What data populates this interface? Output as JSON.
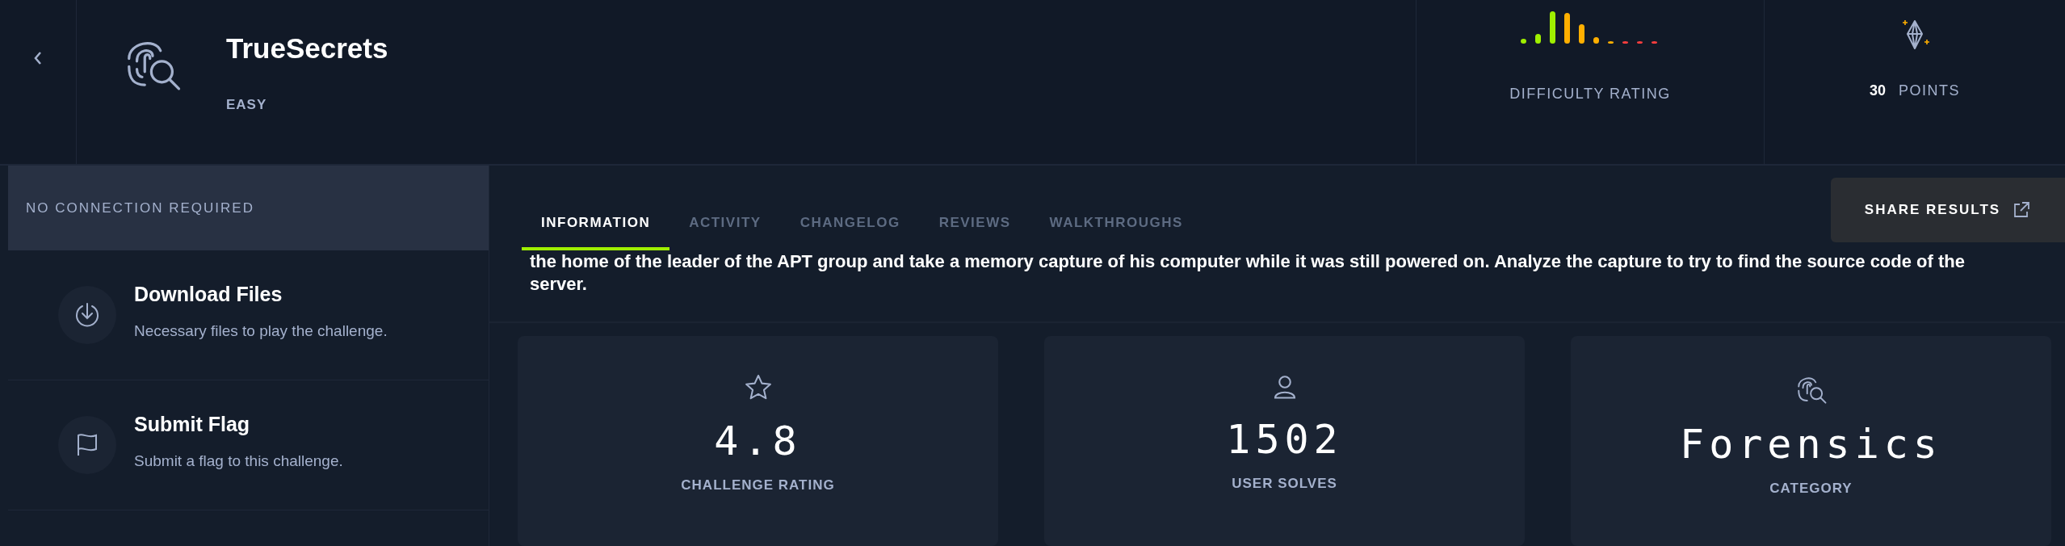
{
  "header": {
    "title": "TrueSecrets",
    "difficulty": "EASY",
    "difficulty_rating_label": "DIFFICULTY RATING",
    "points_value": "30",
    "points_label": "POINTS"
  },
  "sidebar": {
    "banner": "NO CONNECTION REQUIRED",
    "items": [
      {
        "kind": "download",
        "title": "Download Files",
        "subtitle": "Necessary files to play the challenge."
      },
      {
        "kind": "flag",
        "title": "Submit Flag",
        "subtitle": "Submit a flag to this challenge."
      }
    ]
  },
  "tabs": [
    {
      "label": "INFORMATION",
      "selected": true
    },
    {
      "label": "ACTIVITY",
      "selected": false
    },
    {
      "label": "CHANGELOG",
      "selected": false
    },
    {
      "label": "REVIEWS",
      "selected": false
    },
    {
      "label": "WALKTHROUGHS",
      "selected": false
    }
  ],
  "share_button": "SHARE RESULTS",
  "description": "the home of the leader of the APT group and take a memory capture of his computer while it was still powered on. Analyze the capture to try to find the source code of the server.",
  "stats": [
    {
      "kind": "star",
      "value": "4.8",
      "label": "CHALLENGE RATING"
    },
    {
      "kind": "user",
      "value": "1502",
      "label": "USER SOLVES"
    },
    {
      "kind": "forensics",
      "value": "Forensics",
      "label": "CATEGORY"
    }
  ]
}
